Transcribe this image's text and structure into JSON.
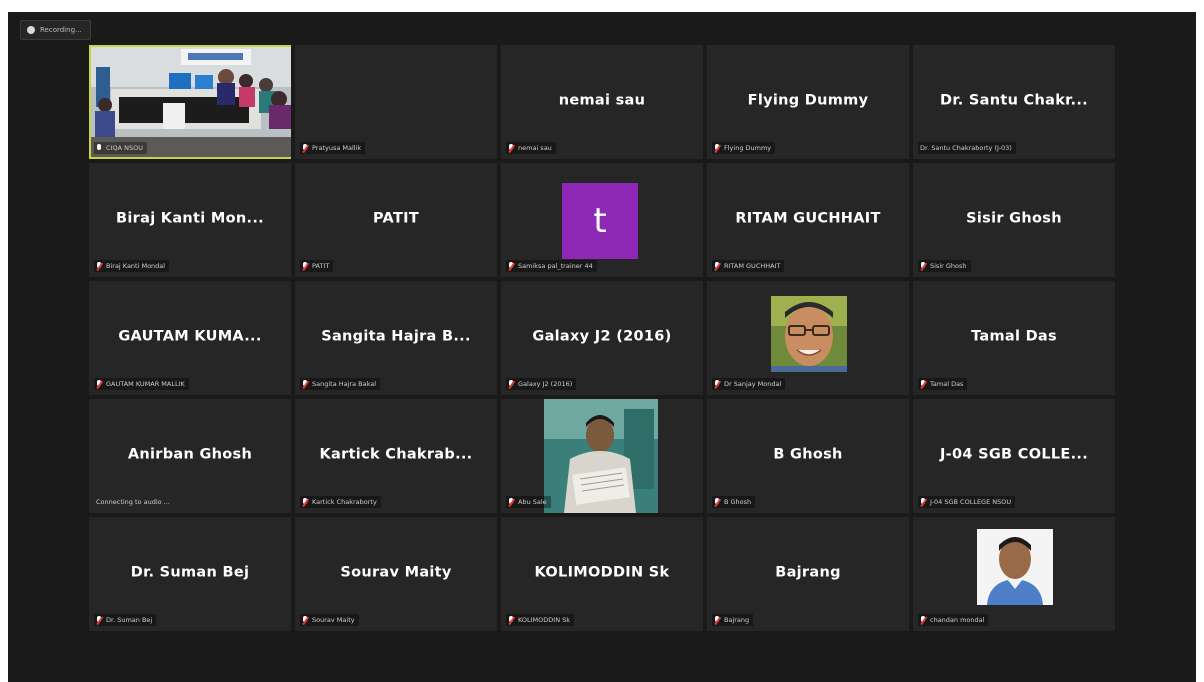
{
  "recording": {
    "label": "Recording..."
  },
  "tiles": [
    {
      "name": "",
      "label": "CIQA NSOU"
    },
    {
      "name": "",
      "label": "Pratyusa Mallik"
    },
    {
      "name": "nemai sau",
      "label": "nemai sau"
    },
    {
      "name": "Flying Dummy",
      "label": "Flying Dummy"
    },
    {
      "name": "Dr. Santu Chakr...",
      "label": "Dr. Santu Chakraborty (J-03)"
    },
    {
      "name": "Biraj Kanti Mon...",
      "label": "Biraj Kanti Mondal"
    },
    {
      "name": "PATIT",
      "label": "PATIT"
    },
    {
      "name": "",
      "label": "Samiksa pal_trainer 44",
      "avatar": "t"
    },
    {
      "name": "RITAM GUCHHAIT",
      "label": "RITAM GUCHHAIT"
    },
    {
      "name": "Sisir Ghosh",
      "label": "Sisir Ghosh"
    },
    {
      "name": "GAUTAM KUMA...",
      "label": "GAUTAM KUMAR MALLIK"
    },
    {
      "name": "Sangita Hajra B...",
      "label": "Sangita Hajra Bakal"
    },
    {
      "name": "Galaxy J2 (2016)",
      "label": "Galaxy J2 (2016)"
    },
    {
      "name": "",
      "label": "Dr Sanjay Mondal"
    },
    {
      "name": "Tamal Das",
      "label": "Tamal Das"
    },
    {
      "name": "Anirban Ghosh",
      "label": "Connecting to audio ..."
    },
    {
      "name": "Kartick Chakrab...",
      "label": "Kartick Chakraborty"
    },
    {
      "name": "",
      "label": "Abu Sale"
    },
    {
      "name": "B Ghosh",
      "label": "B Ghosh"
    },
    {
      "name": "J-04 SGB COLLE...",
      "label": "J-04 SGB COLLEGE NSOU"
    },
    {
      "name": "Dr. Suman Bej",
      "label": "Dr. Suman Bej"
    },
    {
      "name": "Sourav Maity",
      "label": "Sourav Maity"
    },
    {
      "name": "KOLIMODDIN Sk",
      "label": "KOLIMODDIN Sk"
    },
    {
      "name": "Bajrang",
      "label": "Bajrang"
    },
    {
      "name": "",
      "label": "chandan mondal"
    }
  ]
}
